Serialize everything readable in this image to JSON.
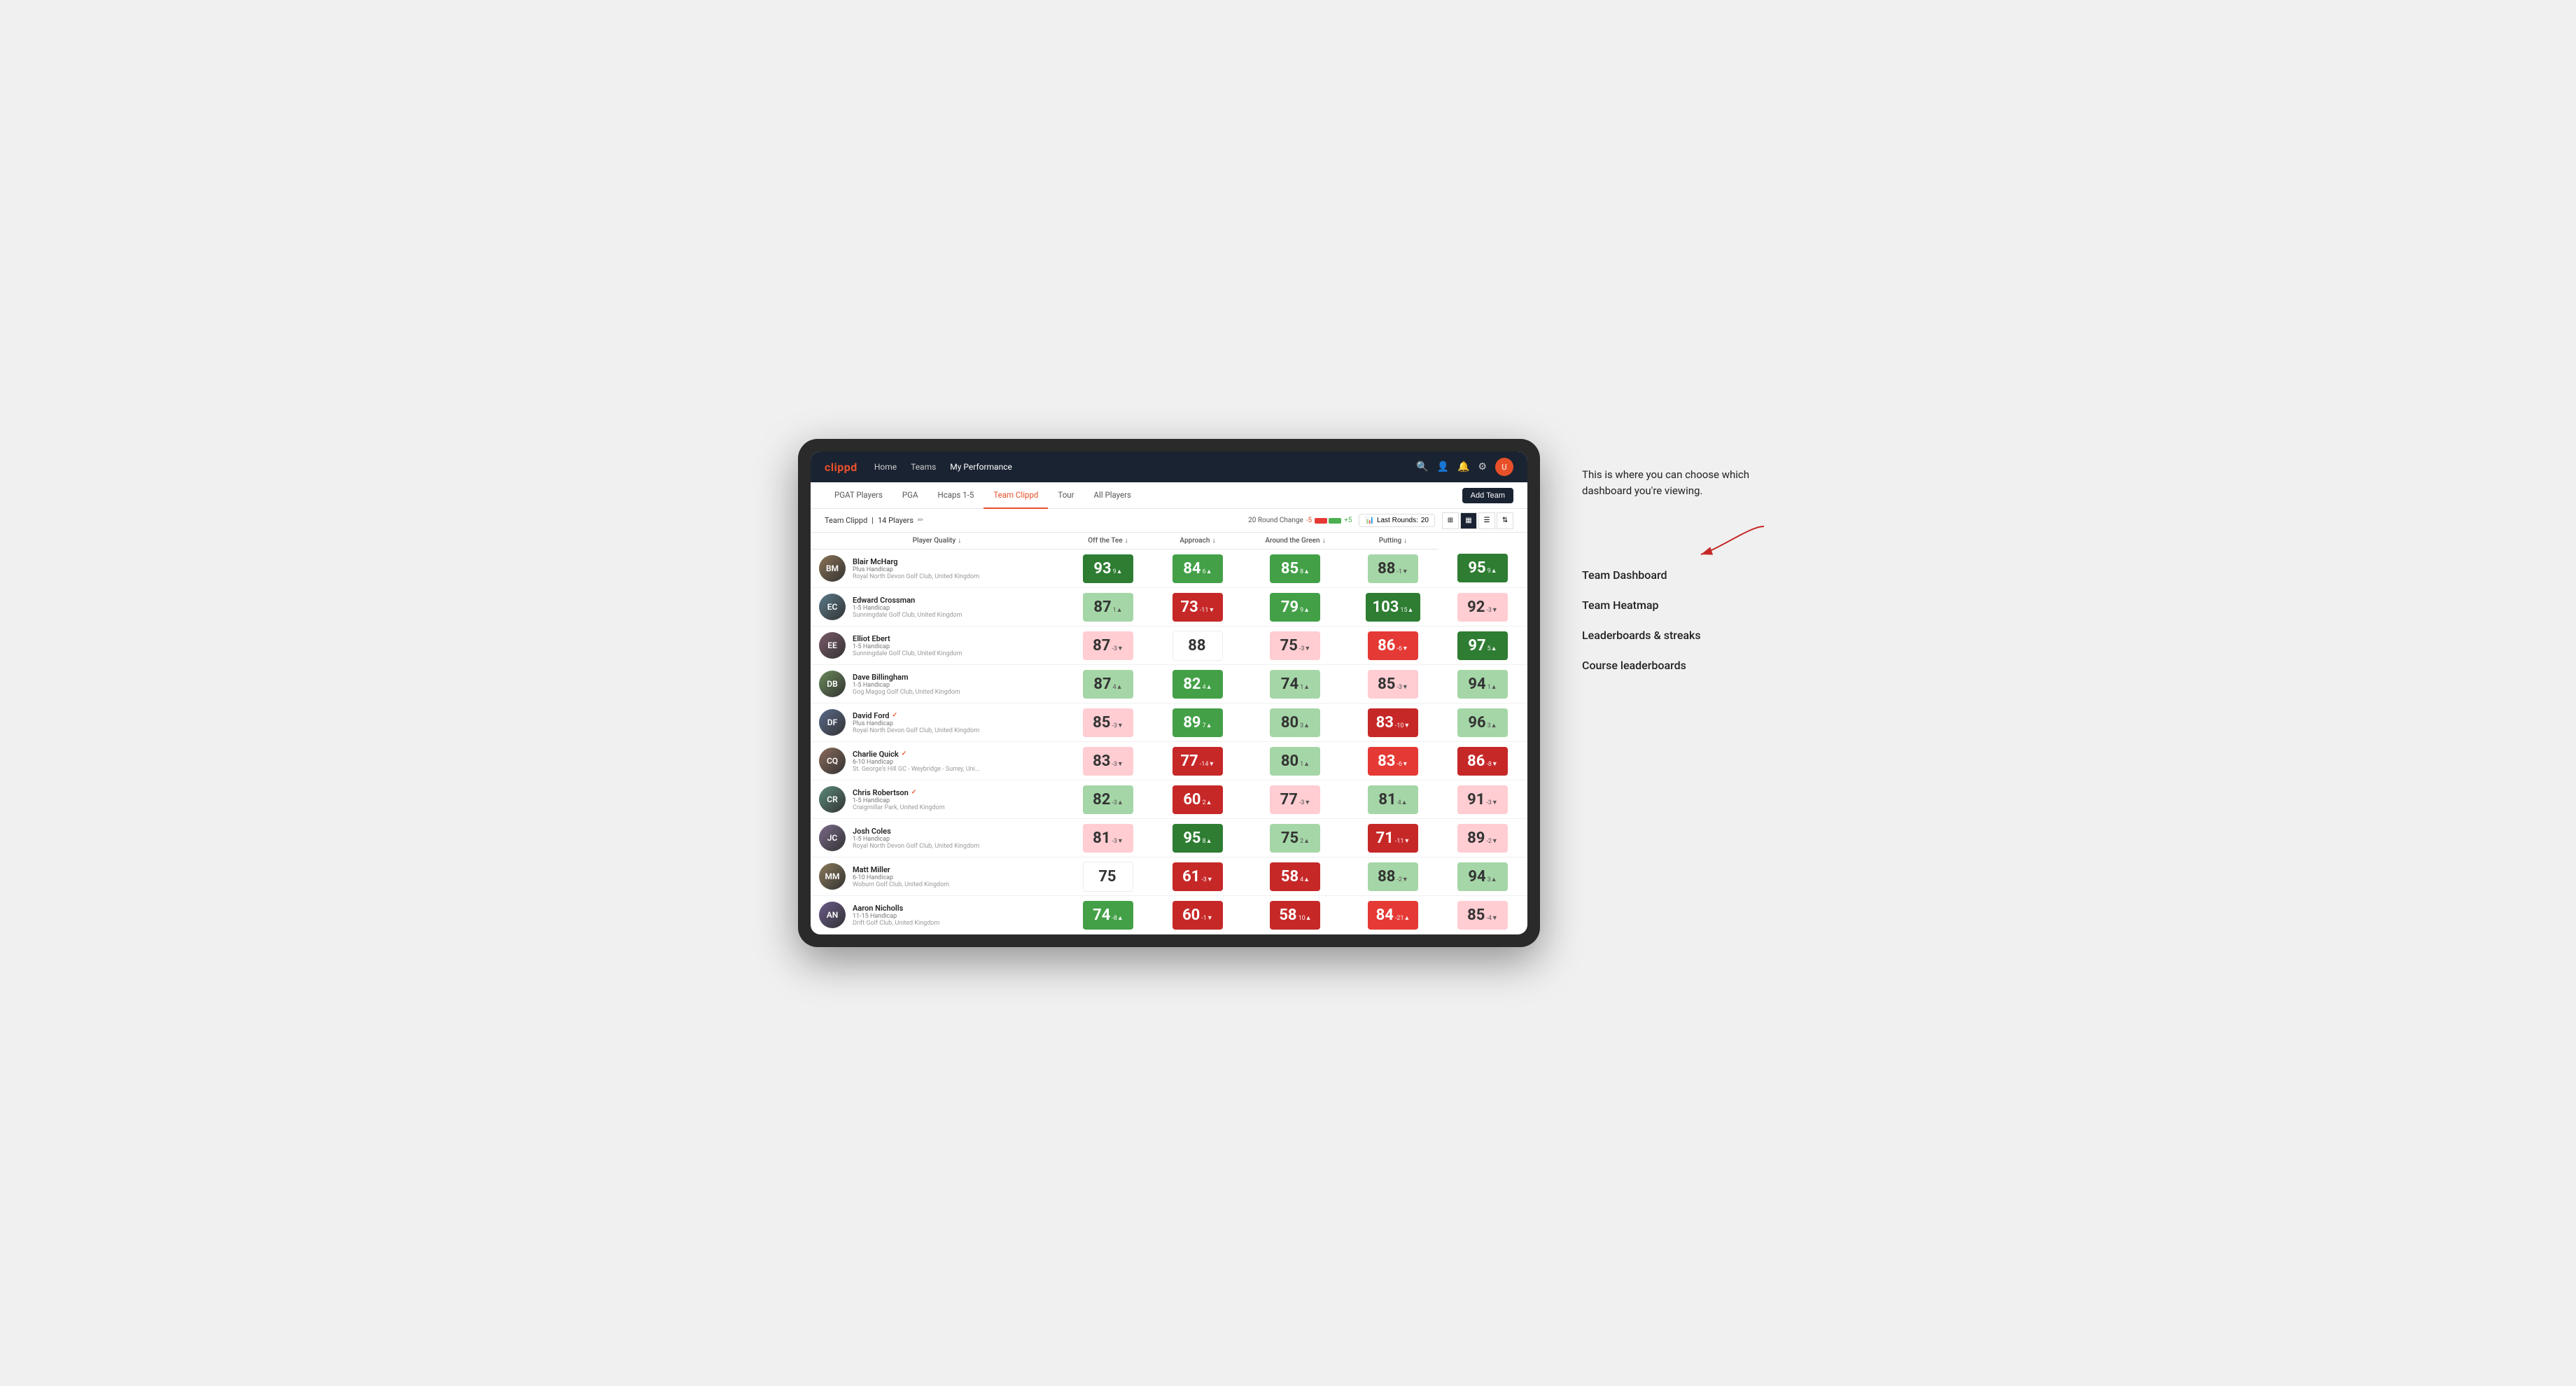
{
  "app": {
    "title": "clippd"
  },
  "nav": {
    "logo": "clippd",
    "links": [
      "Home",
      "Teams",
      "My Performance"
    ],
    "active_link": "My Performance"
  },
  "tabs": {
    "items": [
      "PGAT Players",
      "PGA",
      "Hcaps 1-5",
      "Team Clippd",
      "Tour",
      "All Players"
    ],
    "active": "Team Clippd",
    "add_button": "Add Team"
  },
  "subheader": {
    "team_name": "Team Clippd",
    "player_count": "14 Players",
    "round_change_label": "20 Round Change",
    "change_neg": "-5",
    "change_pos": "+5",
    "last_rounds_label": "Last Rounds:",
    "last_rounds_value": "20"
  },
  "table": {
    "columns": [
      "Player Quality ↓",
      "Off the Tee ↓",
      "Approach ↓",
      "Around the Green ↓",
      "Putting ↓"
    ],
    "players": [
      {
        "name": "Blair McHarg",
        "handicap": "Plus Handicap",
        "club": "Royal North Devon Golf Club, United Kingdom",
        "initials": "BM",
        "scores": [
          {
            "value": "93",
            "change": "9▲",
            "color": "green-dark"
          },
          {
            "value": "84",
            "change": "6▲",
            "color": "green-med"
          },
          {
            "value": "85",
            "change": "8▲",
            "color": "green-med"
          },
          {
            "value": "88",
            "change": "-1▼",
            "color": "green-light"
          },
          {
            "value": "95",
            "change": "9▲",
            "color": "green-dark"
          }
        ]
      },
      {
        "name": "Edward Crossman",
        "handicap": "1-5 Handicap",
        "club": "Sunningdale Golf Club, United Kingdom",
        "initials": "EC",
        "scores": [
          {
            "value": "87",
            "change": "1▲",
            "color": "green-light"
          },
          {
            "value": "73",
            "change": "-11▼",
            "color": "red-dark"
          },
          {
            "value": "79",
            "change": "9▲",
            "color": "green-med"
          },
          {
            "value": "103",
            "change": "15▲",
            "color": "green-dark"
          },
          {
            "value": "92",
            "change": "-3▼",
            "color": "red-light"
          }
        ]
      },
      {
        "name": "Elliot Ebert",
        "handicap": "1-5 Handicap",
        "club": "Sunningdale Golf Club, United Kingdom",
        "initials": "EE",
        "scores": [
          {
            "value": "87",
            "change": "-3▼",
            "color": "red-light"
          },
          {
            "value": "88",
            "change": "",
            "color": "white"
          },
          {
            "value": "75",
            "change": "-3▼",
            "color": "red-light"
          },
          {
            "value": "86",
            "change": "-6▼",
            "color": "red-med"
          },
          {
            "value": "97",
            "change": "5▲",
            "color": "green-dark"
          }
        ]
      },
      {
        "name": "Dave Billingham",
        "handicap": "1-5 Handicap",
        "club": "Gog Magog Golf Club, United Kingdom",
        "initials": "DB",
        "scores": [
          {
            "value": "87",
            "change": "4▲",
            "color": "green-light"
          },
          {
            "value": "82",
            "change": "4▲",
            "color": "green-med"
          },
          {
            "value": "74",
            "change": "1▲",
            "color": "green-light"
          },
          {
            "value": "85",
            "change": "-3▼",
            "color": "red-light"
          },
          {
            "value": "94",
            "change": "1▲",
            "color": "green-light"
          }
        ]
      },
      {
        "name": "David Ford",
        "handicap": "Plus Handicap",
        "club": "Royal North Devon Golf Club, United Kingdom",
        "initials": "DF",
        "verified": true,
        "scores": [
          {
            "value": "85",
            "change": "-3▼",
            "color": "red-light"
          },
          {
            "value": "89",
            "change": "7▲",
            "color": "green-med"
          },
          {
            "value": "80",
            "change": "3▲",
            "color": "green-light"
          },
          {
            "value": "83",
            "change": "-10▼",
            "color": "red-dark"
          },
          {
            "value": "96",
            "change": "3▲",
            "color": "green-light"
          }
        ]
      },
      {
        "name": "Charlie Quick",
        "handicap": "6-10 Handicap",
        "club": "St. George's Hill GC - Weybridge - Surrey, Uni...",
        "initials": "CQ",
        "verified": true,
        "scores": [
          {
            "value": "83",
            "change": "-3▼",
            "color": "red-light"
          },
          {
            "value": "77",
            "change": "-14▼",
            "color": "red-dark"
          },
          {
            "value": "80",
            "change": "1▲",
            "color": "green-light"
          },
          {
            "value": "83",
            "change": "-6▼",
            "color": "red-med"
          },
          {
            "value": "86",
            "change": "-8▼",
            "color": "red-dark"
          }
        ]
      },
      {
        "name": "Chris Robertson",
        "handicap": "1-5 Handicap",
        "club": "Craigmillar Park, United Kingdom",
        "initials": "CR",
        "verified": true,
        "scores": [
          {
            "value": "82",
            "change": "-3▲",
            "color": "green-light"
          },
          {
            "value": "60",
            "change": "2▲",
            "color": "red-dark"
          },
          {
            "value": "77",
            "change": "-3▼",
            "color": "red-light"
          },
          {
            "value": "81",
            "change": "4▲",
            "color": "green-light"
          },
          {
            "value": "91",
            "change": "-3▼",
            "color": "red-light"
          }
        ]
      },
      {
        "name": "Josh Coles",
        "handicap": "1-5 Handicap",
        "club": "Royal North Devon Golf Club, United Kingdom",
        "initials": "JC",
        "scores": [
          {
            "value": "81",
            "change": "-3▼",
            "color": "red-light"
          },
          {
            "value": "95",
            "change": "8▲",
            "color": "green-dark"
          },
          {
            "value": "75",
            "change": "2▲",
            "color": "green-light"
          },
          {
            "value": "71",
            "change": "-11▼",
            "color": "red-dark"
          },
          {
            "value": "89",
            "change": "-2▼",
            "color": "red-light"
          }
        ]
      },
      {
        "name": "Matt Miller",
        "handicap": "6-10 Handicap",
        "club": "Woburn Golf Club, United Kingdom",
        "initials": "MM",
        "scores": [
          {
            "value": "75",
            "change": "",
            "color": "white"
          },
          {
            "value": "61",
            "change": "-3▼",
            "color": "red-dark"
          },
          {
            "value": "58",
            "change": "4▲",
            "color": "red-dark"
          },
          {
            "value": "88",
            "change": "-2▼",
            "color": "green-light"
          },
          {
            "value": "94",
            "change": "3▲",
            "color": "green-light"
          }
        ]
      },
      {
        "name": "Aaron Nicholls",
        "handicap": "11-15 Handicap",
        "club": "Drift Golf Club, United Kingdom",
        "initials": "AN",
        "scores": [
          {
            "value": "74",
            "change": "-8▲",
            "color": "green-med"
          },
          {
            "value": "60",
            "change": "-1▼",
            "color": "red-dark"
          },
          {
            "value": "58",
            "change": "10▲",
            "color": "red-dark"
          },
          {
            "value": "84",
            "change": "-21▲",
            "color": "red-med"
          },
          {
            "value": "85",
            "change": "-4▼",
            "color": "red-light"
          }
        ]
      }
    ]
  },
  "annotation": {
    "intro_text": "This is where you can choose which dashboard you're viewing.",
    "items": [
      "Team Dashboard",
      "Team Heatmap",
      "Leaderboards & streaks",
      "Course leaderboards"
    ]
  }
}
